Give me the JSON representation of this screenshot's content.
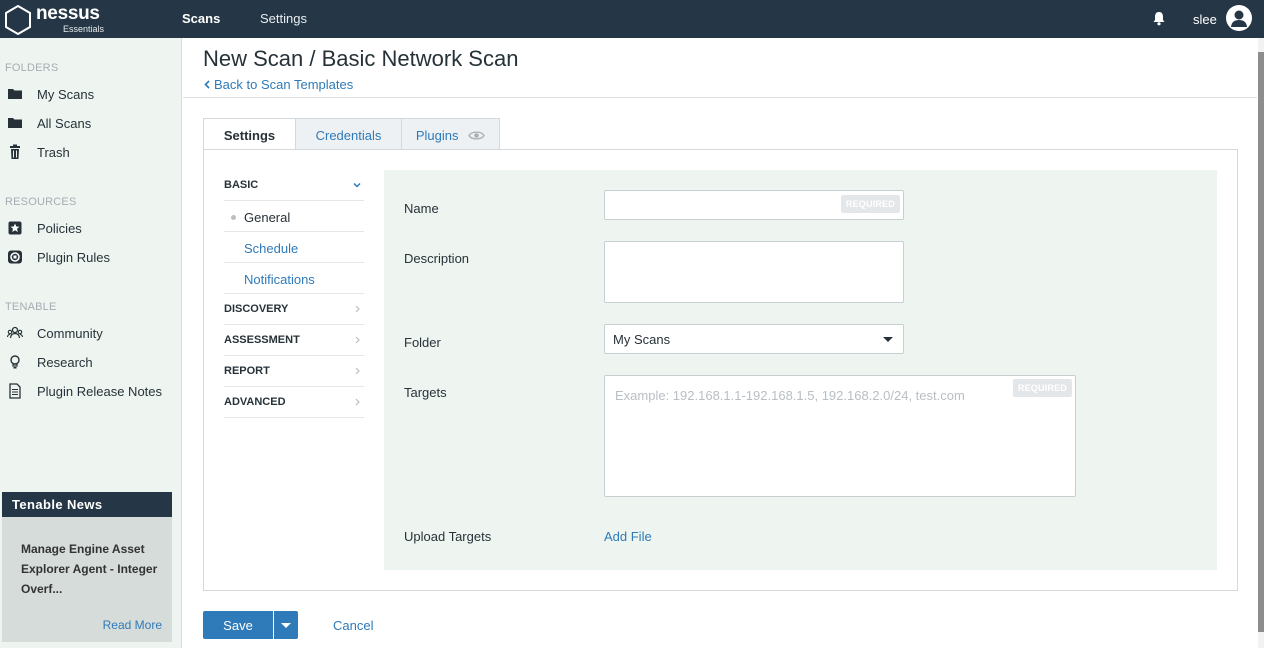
{
  "app": {
    "logo_word": "nessus",
    "logo_sub": "Essentials"
  },
  "topnav": {
    "scans": "Scans",
    "settings": "Settings",
    "user": "slee"
  },
  "sidebar": {
    "folders_head": "FOLDERS",
    "folders": [
      {
        "label": "My Scans",
        "icon": "folder-icon"
      },
      {
        "label": "All Scans",
        "icon": "folder-icon"
      },
      {
        "label": "Trash",
        "icon": "trash-icon"
      }
    ],
    "resources_head": "RESOURCES",
    "resources": [
      {
        "label": "Policies",
        "icon": "policy-badge-icon"
      },
      {
        "label": "Plugin Rules",
        "icon": "plugin-rules-icon"
      }
    ],
    "tenable_head": "TENABLE",
    "tenable": [
      {
        "label": "Community",
        "icon": "community-icon"
      },
      {
        "label": "Research",
        "icon": "lightbulb-icon"
      },
      {
        "label": "Plugin Release Notes",
        "icon": "document-icon"
      }
    ],
    "news": {
      "heading": "Tenable News",
      "title": "Manage Engine Asset Explorer Agent - Integer Overf...",
      "read_more": "Read More"
    }
  },
  "page": {
    "title": "New Scan / Basic Network Scan",
    "back_link": "Back to Scan Templates"
  },
  "tabs": [
    {
      "label": "Settings",
      "active": true
    },
    {
      "label": "Credentials",
      "active": false
    },
    {
      "label": "Plugins",
      "active": false
    }
  ],
  "menu": {
    "basic": "BASIC",
    "basic_items": [
      "General",
      "Schedule",
      "Notifications"
    ],
    "discovery": "DISCOVERY",
    "assessment": "ASSESSMENT",
    "report": "REPORT",
    "advanced": "ADVANCED"
  },
  "form": {
    "name_label": "Name",
    "name_value": "",
    "required_badge": "REQUIRED",
    "description_label": "Description",
    "description_value": "",
    "folder_label": "Folder",
    "folder_value": "My Scans",
    "targets_label": "Targets",
    "targets_placeholder": "Example: 192.168.1.1-192.168.1.5, 192.168.2.0/24, test.com",
    "upload_label": "Upload Targets",
    "add_file": "Add File"
  },
  "actions": {
    "save": "Save",
    "cancel": "Cancel"
  },
  "colors": {
    "topbar": "#253746",
    "link": "#2f7ab8",
    "sidebar_bg": "#eef4f0",
    "primary_button": "#2f7ab8"
  }
}
